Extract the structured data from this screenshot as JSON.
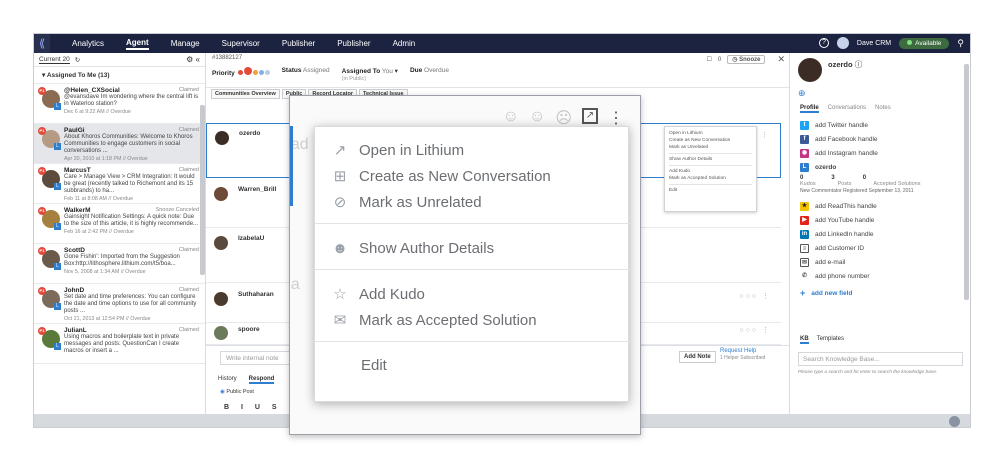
{
  "nav": {
    "items": [
      "Analytics",
      "Agent",
      "Manage",
      "Supervisor",
      "Publisher",
      "Publisher",
      "Admin"
    ],
    "active": "Agent",
    "user": "Dave CRM",
    "availability": "Available"
  },
  "sidebar": {
    "current_label": "Current 20",
    "group_label": "Assigned To Me (13)",
    "conversations": [
      {
        "name": "@Helen_CXSocial",
        "status": "Claimed",
        "snippet": "@evansdave Im wondering where the central lift is in Waterloo station?",
        "meta": "Dec 6 at 9:22 AM // Overdue"
      },
      {
        "name": "PaulGi",
        "status": "Claimed",
        "snippet": "About Khoros Communities: Welcome to Khoros Communities to engage customers in social conversations ...",
        "meta": "Apr 20, 2010 at 1:18 PM // Overdue"
      },
      {
        "name": "MarcusT",
        "status": "Claimed",
        "snippet": "Care > Manage View > CRM Integration: It would be great (recently talked to Richemont and its 15 subbrands) to ha...",
        "meta": "Feb 11 at 8:08 AM // Overdue"
      },
      {
        "name": "WalkerM",
        "status": "Snooze Canceled",
        "snippet": "Gainsight Notification Settings: A quick note: Due to the size of this article, it is highly recommende...",
        "meta": "Feb 16 at 2:42 PM // Overdue"
      },
      {
        "name": "ScottD",
        "status": "Claimed",
        "snippet": "Gone Fishin': Imported from the Suggestion Box:http://lithosphere.lithium.com/t5/boa...",
        "meta": "Nov 5, 2008 at 1:34 AM // Overdue"
      },
      {
        "name": "JohnD",
        "status": "Claimed",
        "snippet": "Set date and time preferences: You can configure the date and time options to use for all community posts ...",
        "meta": "Oct 21, 2013 at 12:54 PM // Overdue"
      },
      {
        "name": "JulianL",
        "status": "Claimed",
        "snippet": "Using macros and boilerplate text in private messages and posts: QuestionCan I create macros or insert a ...",
        "meta": ""
      }
    ]
  },
  "ticket": {
    "id": "#13882127",
    "count": "0",
    "snooze_label": "Snooze",
    "priority_label": "Priority",
    "status_label": "Status",
    "status_value": "Assigned",
    "assigned_label": "Assigned To",
    "assigned_value": "You",
    "assigned_sub": "(in Public)",
    "due_label": "Due",
    "due_value": "Overdue",
    "tabs": [
      "Communities Overview",
      "Public",
      "Record Locator",
      "Technical Issue"
    ]
  },
  "messages": [
    {
      "author": "ozerdo"
    },
    {
      "author": "Warren_Brill"
    },
    {
      "author": "IzabelaU"
    },
    {
      "author": "Suthaharan"
    },
    {
      "author": "spoore"
    }
  ],
  "compose": {
    "placeholder": "Write internal note",
    "add_note": "Add Note",
    "request_help": "Request Help",
    "helper_sub": "1 Helper Subscribed",
    "tabs": [
      "History",
      "Respond"
    ],
    "radio_label": "Public Post",
    "tools": "B I U S \""
  },
  "mini_menu": {
    "items": [
      "Open in Lithium",
      "Create as New Conversation",
      "Mark as Unrelated",
      "Show Author Details",
      "Add Kudo",
      "Mark as Accepted Solution",
      "Edit"
    ]
  },
  "zoom_menu": {
    "open": "Open in Lithium",
    "create": "Create as New Conversation",
    "unrelated": "Mark as Unrelated",
    "author": "Show Author Details",
    "kudo": "Add Kudo",
    "accepted": "Mark as Accepted Solution",
    "edit": "Edit"
  },
  "right_panel": {
    "name": "ozerdo",
    "tabs": [
      "Profile",
      "Conversations",
      "Notes"
    ],
    "links": [
      "add Twitter handle",
      "add Facebook handle",
      "add Instagram handle"
    ],
    "community_name": "ozerdo",
    "stats": {
      "kudos": "0",
      "posts": "3",
      "accepted": "0",
      "kudos_label": "Kudos",
      "posts_label": "Posts",
      "accepted_label": "Accepted Solutions"
    },
    "rank_line": "New Commentator Registered September 13, 2011",
    "more_links": [
      "add ReadThis handle",
      "add YouTube handle",
      "add LinkedIn handle",
      "add Customer ID",
      "add e-mail",
      "add phone number"
    ],
    "add_field": "add new field",
    "kb_tabs": [
      "KB",
      "Templates"
    ],
    "kb_placeholder": "Search Knowledge Base...",
    "kb_hint": "Please type a search and hit enter to search the knowledge base."
  },
  "colors": {
    "nav_bg": "#1c2340",
    "accent": "#2d7ecf",
    "priority": "#e24a3a"
  }
}
